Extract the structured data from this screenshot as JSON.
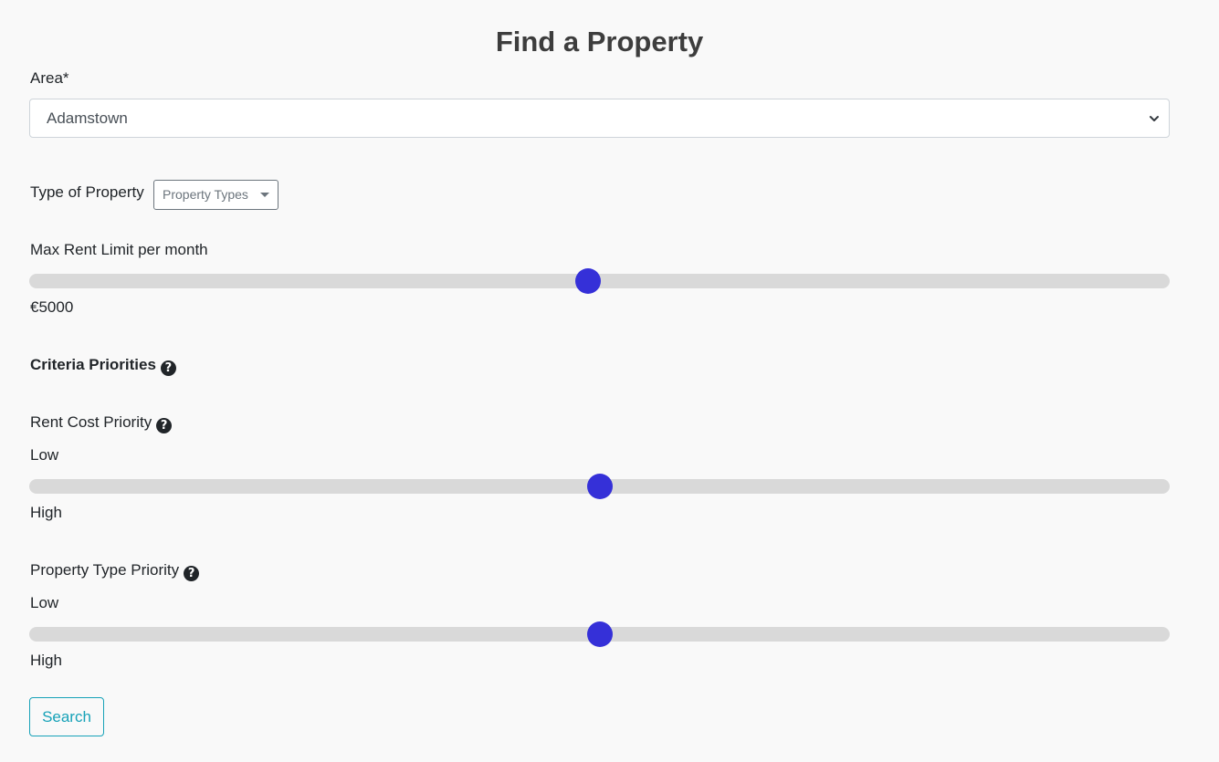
{
  "page": {
    "title": "Find a Property"
  },
  "area": {
    "label": "Area*",
    "selected": "Adamstown"
  },
  "property_type": {
    "label": "Type of Property",
    "dropdown_label": "Property Types"
  },
  "max_rent": {
    "label": "Max Rent Limit per month",
    "value_text": "€5000",
    "slider_fraction": 0.49
  },
  "criteria": {
    "heading": "Criteria Priorities",
    "help_icon": "question-circle-icon"
  },
  "rent_cost_priority": {
    "label": "Rent Cost Priority",
    "low_label": "Low",
    "high_label": "High",
    "slider_fraction": 0.5
  },
  "property_type_priority": {
    "label": "Property Type Priority",
    "low_label": "Low",
    "high_label": "High",
    "slider_fraction": 0.5
  },
  "actions": {
    "search_label": "Search"
  },
  "colors": {
    "slider_thumb": "#3530d8",
    "slider_track": "#d9d9d9",
    "search_button": "#17a2b8",
    "background": "#f9f9f9"
  }
}
